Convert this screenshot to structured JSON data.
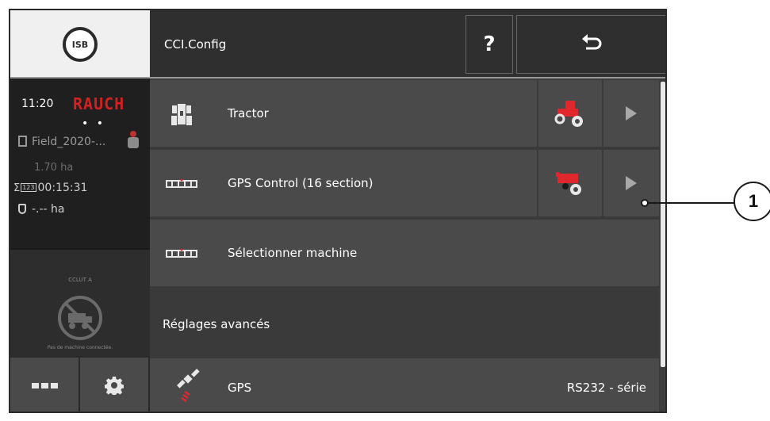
{
  "header": {
    "title": "CCI.Config",
    "help_label": "?"
  },
  "status": {
    "isb_label": "ISB",
    "time": "11:20",
    "brand": "RAUCH",
    "dots": "• •",
    "field": "Field_2020-...",
    "area": "1.70 ha",
    "duration_sigma": "Σ",
    "duration_tag": "123",
    "duration": "00:15:31",
    "hectares": "-.-- ha",
    "machine_code": "CCLUT A",
    "no_machine": "Pas de machine connectée."
  },
  "list": {
    "rows": [
      {
        "label": "Tractor"
      },
      {
        "label": "GPS Control (16 section)"
      },
      {
        "label": "Sélectionner machine"
      }
    ],
    "section_header": "Réglages avancés",
    "gps": {
      "label": "GPS",
      "value": "RS232 - série"
    }
  },
  "callout": {
    "number": "1"
  },
  "colors": {
    "brand": "#d42020",
    "accent": "#e0282c",
    "panel": "#4a4a4a",
    "header": "#2f2f2f"
  }
}
